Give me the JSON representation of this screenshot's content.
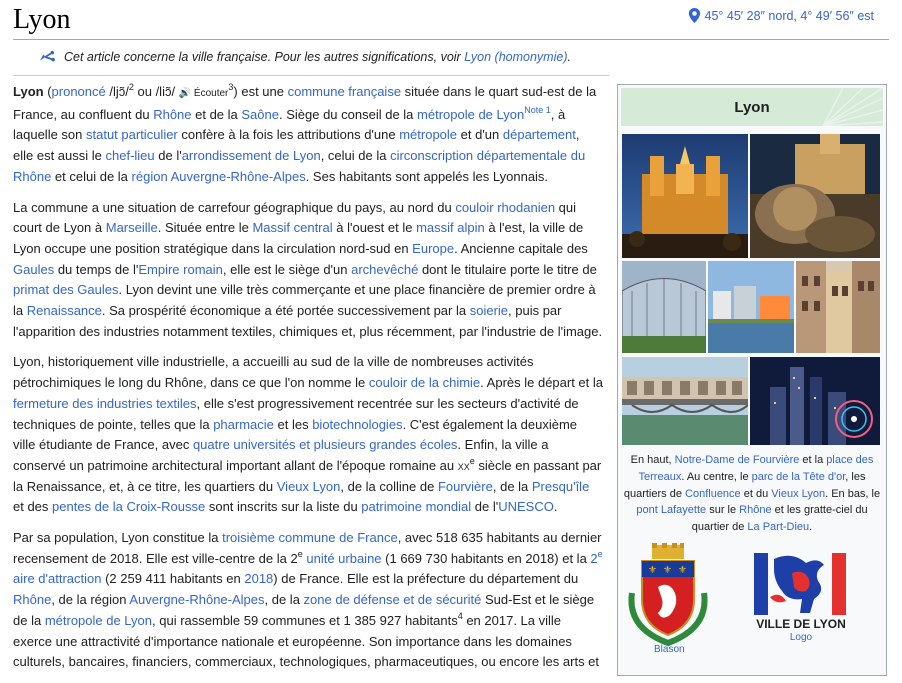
{
  "page": {
    "title": "Lyon",
    "coordinates": "45° 45′ 28″ nord, 4° 49′ 56″ est"
  },
  "hatnote": {
    "text": "Cet article concerne la ville française. Pour les autres significations, voir ",
    "link": "Lyon (homonymie)",
    "end": "."
  },
  "paragraphs": [
    [
      {
        "t": "Lyon",
        "b": true
      },
      {
        "t": " ("
      },
      {
        "t": "prononcé",
        "l": true
      },
      {
        "t": " /ljɔ̃/"
      },
      {
        "t": "2",
        "s": true
      },
      {
        "t": " ou /liɔ̃/ "
      },
      {
        "t": "🔊",
        "sp": true
      },
      {
        "t": " Écouter",
        "sm": true
      },
      {
        "t": "3",
        "s": true
      },
      {
        "t": ") est une "
      },
      {
        "t": "commune française",
        "l": true
      },
      {
        "t": " située dans le quart sud-est de la France, au confluent du "
      },
      {
        "t": "Rhône",
        "l": true
      },
      {
        "t": " et de la "
      },
      {
        "t": "Saône",
        "l": true
      },
      {
        "t": ". Siège du conseil de la "
      },
      {
        "t": "métropole de Lyon",
        "l": true
      },
      {
        "t": "Note 1",
        "s": true,
        "l": true
      },
      {
        "t": ", à laquelle son "
      },
      {
        "t": "statut particulier",
        "l": true
      },
      {
        "t": " confère à la fois les attributions d'une "
      },
      {
        "t": "métropole",
        "l": true
      },
      {
        "t": " et d'un "
      },
      {
        "t": "département",
        "l": true
      },
      {
        "t": ", elle est aussi le "
      },
      {
        "t": "chef-lieu",
        "l": true
      },
      {
        "t": " de l'"
      },
      {
        "t": "arrondissement de Lyon",
        "l": true
      },
      {
        "t": ", celui de la "
      },
      {
        "t": "circonscription départementale du Rhône",
        "l": true
      },
      {
        "t": " et celui de la "
      },
      {
        "t": "région Auvergne-Rhône-Alpes",
        "l": true
      },
      {
        "t": ". Ses habitants sont appelés les Lyonnais."
      }
    ],
    [
      {
        "t": "La commune a une situation de carrefour géographique du pays, au nord du "
      },
      {
        "t": "couloir rhodanien",
        "l": true
      },
      {
        "t": " qui court de Lyon à "
      },
      {
        "t": "Marseille",
        "l": true
      },
      {
        "t": ". Située entre le "
      },
      {
        "t": "Massif central",
        "l": true
      },
      {
        "t": " à l'ouest et le "
      },
      {
        "t": "massif alpin",
        "l": true
      },
      {
        "t": " à l'est, la ville de Lyon occupe une position stratégique dans la circulation nord-sud en "
      },
      {
        "t": "Europe",
        "l": true
      },
      {
        "t": ". Ancienne capitale des "
      },
      {
        "t": "Gaules",
        "l": true
      },
      {
        "t": " du temps de l'"
      },
      {
        "t": "Empire romain",
        "l": true
      },
      {
        "t": ", elle est le siège d'un "
      },
      {
        "t": "archevêché",
        "l": true
      },
      {
        "t": " dont le titulaire porte le titre de "
      },
      {
        "t": "primat des Gaules",
        "l": true
      },
      {
        "t": ". Lyon devint une ville très commerçante et une place financière de premier ordre à la "
      },
      {
        "t": "Renaissance",
        "l": true
      },
      {
        "t": ". Sa prospérité économique a été portée successivement par la "
      },
      {
        "t": "soierie",
        "l": true
      },
      {
        "t": ", puis par l'apparition des industries notamment textiles, chimiques et, plus récemment, par l'industrie de l'image."
      }
    ],
    [
      {
        "t": "Lyon, historiquement ville industrielle, a accueilli au sud de la ville de nombreuses activités pétrochimiques le long du Rhône, dans ce que l'on nomme le "
      },
      {
        "t": "couloir de la chimie",
        "l": true
      },
      {
        "t": ". Après le départ et la "
      },
      {
        "t": "fermeture des industries textiles",
        "l": true
      },
      {
        "t": ", elle s'est progressivement recentrée sur les secteurs d'activité de techniques de pointe, telles que la "
      },
      {
        "t": "pharmacie",
        "l": true
      },
      {
        "t": " et les "
      },
      {
        "t": "biotechnologies",
        "l": true
      },
      {
        "t": ". C'est également la deuxième ville étudiante de France, avec "
      },
      {
        "t": "quatre universités et plusieurs grandes écoles",
        "l": true
      },
      {
        "t": ". Enfin, la ville a conservé un patrimoine architectural important allant de l'époque romaine au "
      },
      {
        "t": "xx",
        "sc": true
      },
      {
        "t": "e",
        "s": true
      },
      {
        "t": " siècle en passant par la Renaissance, et, à ce titre, les quartiers du "
      },
      {
        "t": "Vieux Lyon",
        "l": true
      },
      {
        "t": ", de la colline de "
      },
      {
        "t": "Fourvière",
        "l": true
      },
      {
        "t": ", de la "
      },
      {
        "t": "Presqu'île",
        "l": true
      },
      {
        "t": " et des "
      },
      {
        "t": "pentes de la Croix-Rousse",
        "l": true
      },
      {
        "t": " sont inscrits sur la liste du "
      },
      {
        "t": "patrimoine mondial",
        "l": true
      },
      {
        "t": " de l'"
      },
      {
        "t": "UNESCO",
        "l": true
      },
      {
        "t": "."
      }
    ],
    [
      {
        "t": "Par sa population, Lyon constitue la "
      },
      {
        "t": "troisième commune de France",
        "l": true
      },
      {
        "t": ", avec 518 635 habitants au dernier recensement de 2018. Elle est ville-centre de la 2"
      },
      {
        "t": "e",
        "s": true
      },
      {
        "t": " "
      },
      {
        "t": "unité urbaine",
        "l": true
      },
      {
        "t": " (1 669 730 habitants en 2018) et la "
      },
      {
        "t": "2",
        "l": true
      },
      {
        "t": "e",
        "s": true,
        "l": true
      },
      {
        "t": " aire d'attraction",
        "l": true
      },
      {
        "t": " (2 259 411 habitants en "
      },
      {
        "t": "2018",
        "l": true
      },
      {
        "t": ") de France. Elle est la préfecture du département du "
      },
      {
        "t": "Rhône",
        "l": true
      },
      {
        "t": ", de la région "
      },
      {
        "t": "Auvergne-Rhône-Alpes",
        "l": true
      },
      {
        "t": ", de la "
      },
      {
        "t": "zone de défense et de sécurité",
        "l": true
      },
      {
        "t": " Sud-Est et le siège de la "
      },
      {
        "t": "métropole de Lyon",
        "l": true
      },
      {
        "t": ", qui rassemble 59 communes et 1 385 927 habitants"
      },
      {
        "t": "4",
        "s": true
      },
      {
        "t": " en 2017. La ville exerce une attractivité d'importance nationale et européenne. Son importance dans les domaines culturels, bancaires, financiers, commerciaux, technologiques, pharmaceutiques, ou encore les arts et"
      }
    ]
  ],
  "infobox": {
    "title": "Lyon",
    "caption": [
      {
        "t": "En haut, "
      },
      {
        "t": "Notre-Dame de Fourvière",
        "l": true
      },
      {
        "t": " et la "
      },
      {
        "t": "place des Terreaux",
        "l": true
      },
      {
        "t": ". Au centre, le "
      },
      {
        "t": "parc de la Tête d'or",
        "l": true
      },
      {
        "t": ", les quartiers de "
      },
      {
        "t": "Confluence",
        "l": true
      },
      {
        "t": " et du "
      },
      {
        "t": "Vieux Lyon",
        "l": true
      },
      {
        "t": ". En bas, le "
      },
      {
        "t": "pont Lafayette",
        "l": true
      },
      {
        "t": " sur le "
      },
      {
        "t": "Rhône",
        "l": true
      },
      {
        "t": " et les gratte-ciel du quartier de "
      },
      {
        "t": "La Part-Dieu",
        "l": true
      },
      {
        "t": "."
      }
    ],
    "blason_label": "Blason",
    "logo_label": "Logo",
    "logo_text": "VILLE DE LYON"
  },
  "colors": {
    "link": "#3366cc",
    "infobox_header": "#d6ead8"
  }
}
